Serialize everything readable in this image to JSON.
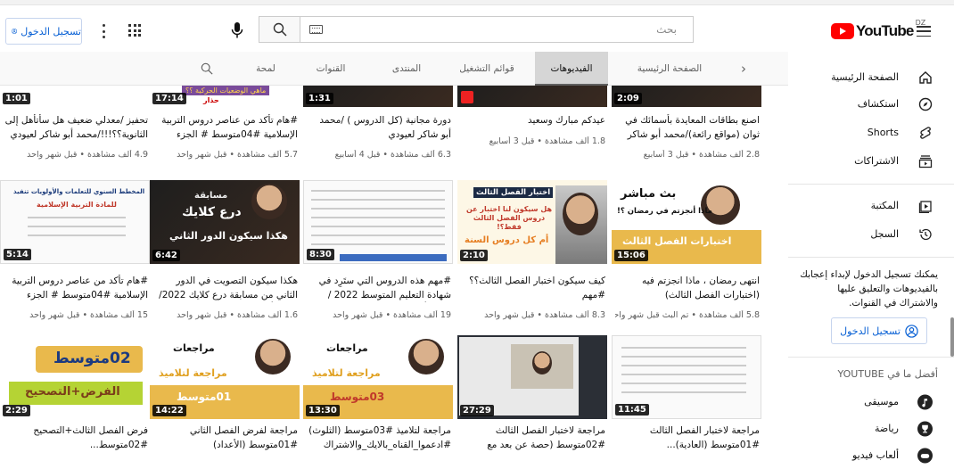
{
  "header": {
    "signin_label": "تسجيل الدخول",
    "search_placeholder": "بحث",
    "logo_text": "YouTube",
    "country_code": "DZ"
  },
  "tabs": {
    "items": [
      "الصفحة الرئيسية",
      "الفيديوهات",
      "قوائم التشغيل",
      "المنتدى",
      "القنوات",
      "لمحة"
    ],
    "active": "الفيديوهات"
  },
  "sidebar": {
    "items": [
      {
        "label": "الصفحة الرئيسية",
        "icon": "home-icon"
      },
      {
        "label": "استكشاف",
        "icon": "explore-icon"
      },
      {
        "label": "Shorts",
        "icon": "shorts-icon"
      },
      {
        "label": "الاشتراكات",
        "icon": "subscriptions-icon"
      },
      {
        "label": "المكتبة",
        "icon": "library-icon"
      },
      {
        "label": "السجل",
        "icon": "history-icon"
      }
    ],
    "signin_note": "يمكنك تسجيل الدخول لإبداء إعجابك بالفيديوهات والتعليق عليها والاشتراك في القنوات.",
    "signin_label": "تسجيل الدخول",
    "best_of_heading": "أفضل ما في YOUTUBE",
    "best_items": [
      {
        "label": "موسيقى",
        "icon": "music-icon"
      },
      {
        "label": "رياضة",
        "icon": "sports-icon"
      },
      {
        "label": "ألعاب فيديو",
        "icon": "gaming-icon"
      }
    ]
  },
  "videos": [
    {
      "title": "اصنع بطاقات المعايدة بأسمائك في ثوان (مواقع رائعة)/محمد أبو شاكر لعيودي",
      "meta": "2.8 ألف مشاهدة • قبل 3 أسابيع",
      "duration": "2:09",
      "art": "dark"
    },
    {
      "title": "عيدكم مبارك وسعيد",
      "meta": "1.8 ألف مشاهدة • قبل 3 أسابيع",
      "duration": "",
      "art": "dark"
    },
    {
      "title": "دورة مجانية (كل الدروس ) /محمد أبو شاكر لعيودي",
      "meta": "6.3 ألف مشاهدة • قبل 4 أسابيع",
      "duration": "1:31",
      "art": "dark"
    },
    {
      "title": "#هام تأكد من عناصر دروس التربية الإسلامية #04متوسط # الجزء الثاني...",
      "meta": "5.7 ألف مشاهدة • قبل شهر واحد",
      "duration": "17:14",
      "art": "gold"
    },
    {
      "title": "تحفيز /معدلي ضعيف هل سأتأهل إلى الثانوية؟؟!!!/محمد أبو شاكر لعيودي",
      "meta": "4.9 ألف مشاهدة • قبل شهر واحد",
      "duration": "1:01",
      "art": "red"
    },
    {
      "title": "انتهى رمضان ، ماذا انجزتم فيه (اختبارات الفصل الثالث)",
      "meta": "5.8 ألف مشاهدة • تم البث قبل شهر واحد",
      "duration": "15:06",
      "art": "gold"
    },
    {
      "title": "كيف سيكون اختبار الفصل الثالث؟؟ #مهم #ادعموا_القناه_بالايك_والاشتراك",
      "meta": "8.3 ألف مشاهدة • قبل شهر واحد",
      "duration": "2:10",
      "art": "gold"
    },
    {
      "title": "#مهم هذه الدروس التي ستَرِد في شهادة التعليم المتوسط 2022 /محمد أبو شاكر...",
      "meta": "19 ألف مشاهدة • قبل شهر واحد",
      "duration": "8:30",
      "art": "doc"
    },
    {
      "title": "هكذا سيكون التصويت في الدور الثاني من مسابقة درع كلايك 2022/محمد أبو شاك...",
      "meta": "1.6 ألف مشاهدة • قبل شهر واحد",
      "duration": "6:42",
      "art": "dark"
    },
    {
      "title": "#هام تأكد من عناصر دروس التربية الإسلامية #04متوسط # الجزء الأول...",
      "meta": "15 ألف مشاهدة • قبل شهر واحد",
      "duration": "5:14",
      "art": "doc"
    },
    {
      "title": "مراجعة لاختبار الفصل الثالث #01متوسط (العادية)...",
      "meta": "",
      "duration": "11:45",
      "art": "doc"
    },
    {
      "title": "مراجعة لاختبار الفصل الثالث #02متوسط (حصة عن بعد مع تلاميذ...",
      "meta": "",
      "duration": "27:29",
      "art": "dark"
    },
    {
      "title": "مراجعة لتلاميذ #03متوسط (الثلوث) #ادعموا_القناه_بالايك_والاشتراك",
      "meta": "",
      "duration": "13:30",
      "art": "gold"
    },
    {
      "title": "مراجعة لفرض الفصل الثاني #01متوسط (الأعداد)",
      "meta": "",
      "duration": "14:22",
      "art": "gold"
    },
    {
      "title": "فرض الفصل الثالث+التصحيح #02متوسط...",
      "meta": "",
      "duration": "2:29",
      "art": "gold"
    }
  ],
  "thumb_text": {
    "t0_live": "بث مباشر",
    "t0_q": "ماذا أنجزتم في رمضان ؟!",
    "t0_exam": "اختبارات الفصل الثالث",
    "t1_head": "اختبار الفصل الثالث",
    "t1_q": "هل سيكون لنا اختبار عن دروس الفصل الثالث فقط؟!",
    "t1_all": "أم كل دروس السنة",
    "t3_contest": "مسابقة",
    "t3_shield": "درع كلايك",
    "t3_second": "هكذا سيكون الدور الثاني",
    "t4_plan": "المخطط السنوي للتعلمات والأولويات تنفيذ",
    "t4_subject": "للمادة التربية الإسلامية",
    "t7_review": "مراجعات",
    "t7_sub": "مراجعة لتلاميذ",
    "t7_level": "03متوسط",
    "t8_review": "مراجعات",
    "t8_sub": "مراجعة لتلاميذ",
    "t8_level": "01متوسط",
    "t9_level": "02متوسط",
    "t9_sub": "الفرض+التصحيح",
    "t_warn": "ماهي الوضعيات الحركية ؟؟",
    "t_warn2": "حذار"
  },
  "colors": {
    "accent_blue": "#065fd4",
    "youtube_red": "#ff0000",
    "gold": "#e8c36a",
    "tab_active_bg": "#d6d6d6"
  }
}
